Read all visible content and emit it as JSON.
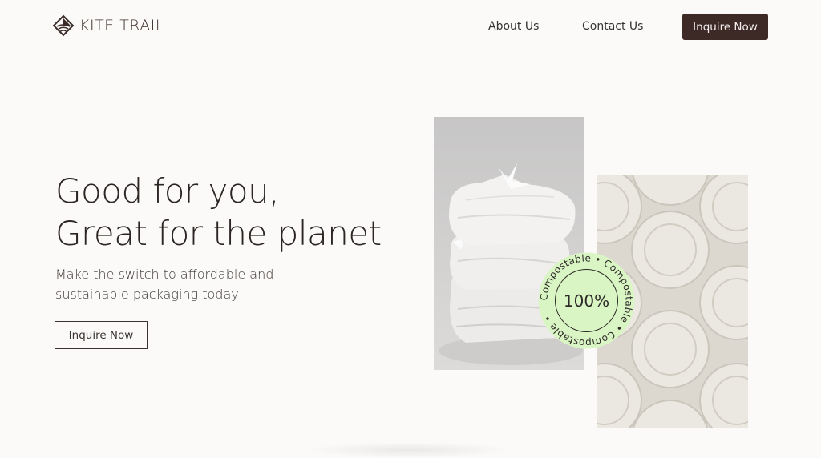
{
  "brand": {
    "name": "KITE TRAIL",
    "logo_icon": "diamond-field-icon"
  },
  "nav": {
    "about_label": "About Us",
    "contact_label": "Contact Us",
    "cta_label": "Inquire Now"
  },
  "hero": {
    "title_line1": "Good for you,",
    "title_line2": "Great for the planet",
    "subtitle_line1": "Make the switch to affordable and",
    "subtitle_line2": "sustainable packaging today",
    "cta_label": "Inquire Now"
  },
  "badge": {
    "percent": "100%",
    "ring_text": "Compostable • Compostable • Compostable •",
    "color": "#d9f5c4"
  },
  "colors": {
    "background": "#fbfaf8",
    "brand_dark": "#3d2a27"
  }
}
